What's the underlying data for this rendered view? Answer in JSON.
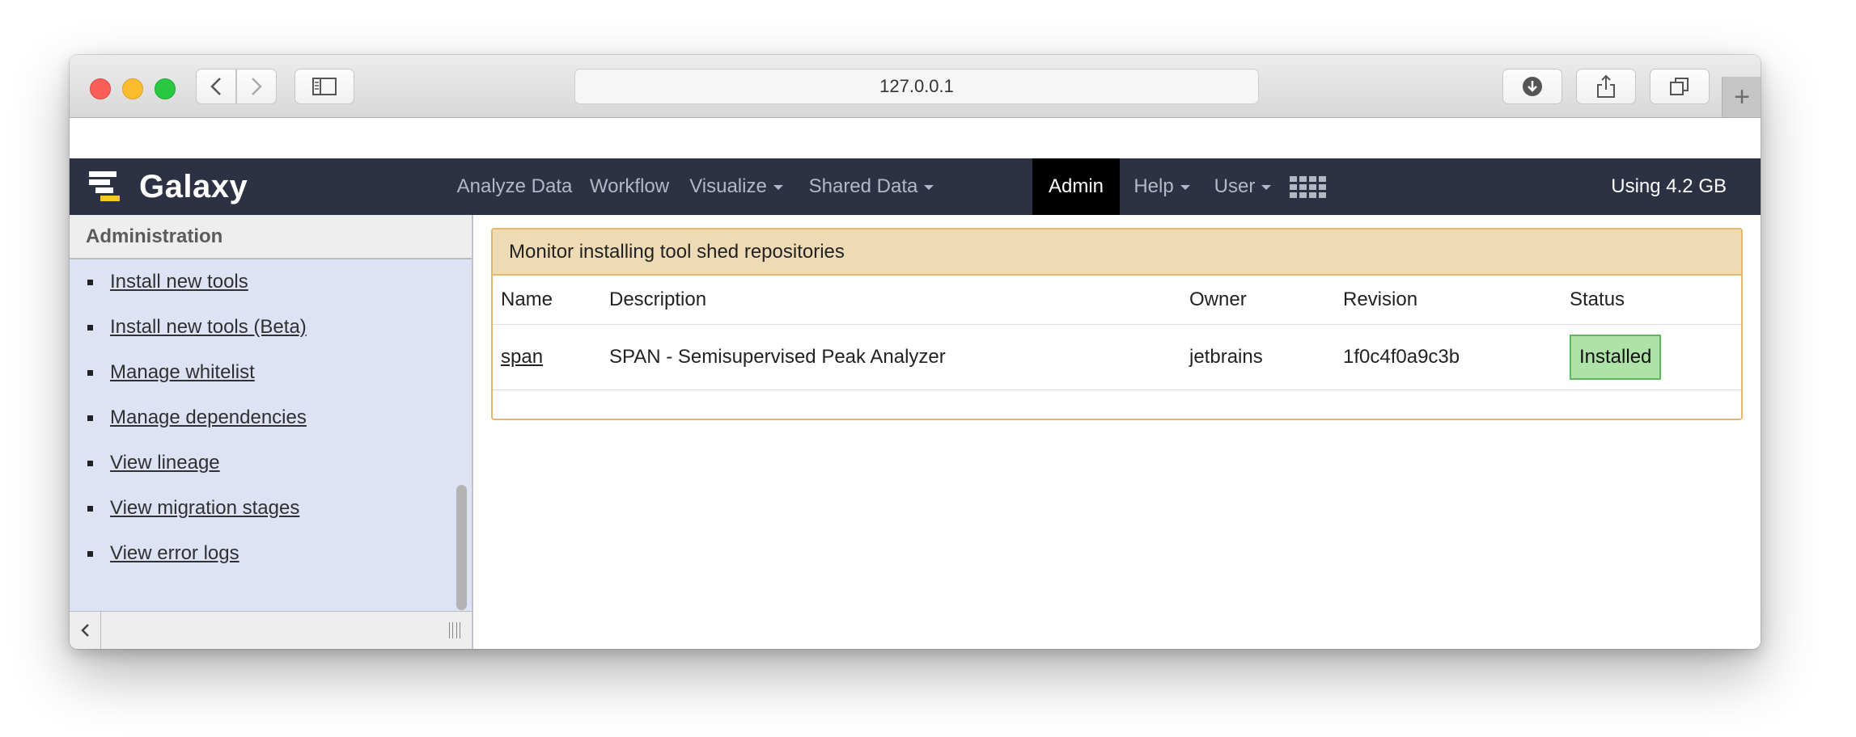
{
  "browser": {
    "url": "127.0.0.1",
    "new_tab_symbol": "+"
  },
  "masthead": {
    "brand": "Galaxy",
    "nav": [
      {
        "label": "Analyze Data",
        "dropdown": false
      },
      {
        "label": "Workflow",
        "dropdown": false
      },
      {
        "label": "Visualize",
        "dropdown": true
      },
      {
        "label": "Shared Data",
        "dropdown": true
      },
      {
        "label": "Admin",
        "dropdown": false,
        "active": true
      },
      {
        "label": "Help",
        "dropdown": true
      },
      {
        "label": "User",
        "dropdown": true
      }
    ],
    "apps_icon": "grid-icon",
    "quota": "Using 4.2 GB"
  },
  "sidebar": {
    "title": "Administration",
    "items": [
      {
        "label": "Install new tools"
      },
      {
        "label": "Install new tools (Beta)"
      },
      {
        "label": "Manage whitelist"
      },
      {
        "label": "Manage dependencies"
      },
      {
        "label": "View lineage"
      },
      {
        "label": "View migration stages"
      },
      {
        "label": "View error logs"
      }
    ]
  },
  "main": {
    "panel_title": "Monitor installing tool shed repositories",
    "columns": [
      "Name",
      "Description",
      "Owner",
      "Revision",
      "Status"
    ],
    "rows": [
      {
        "name": "span",
        "description": "SPAN - Semisupervised Peak Analyzer",
        "owner": "jetbrains",
        "revision": "1f0c4f0a9c3b",
        "status": "Installed"
      }
    ]
  },
  "colors": {
    "masthead_bg": "#2c3143",
    "admin_active_bg": "#000000",
    "sidebar_bg": "#dde3f5",
    "panel_border": "#e5b76c",
    "panel_header_bg": "#eedbb6",
    "status_installed_bg": "#aee2a8",
    "status_installed_border": "#5cb85c"
  }
}
